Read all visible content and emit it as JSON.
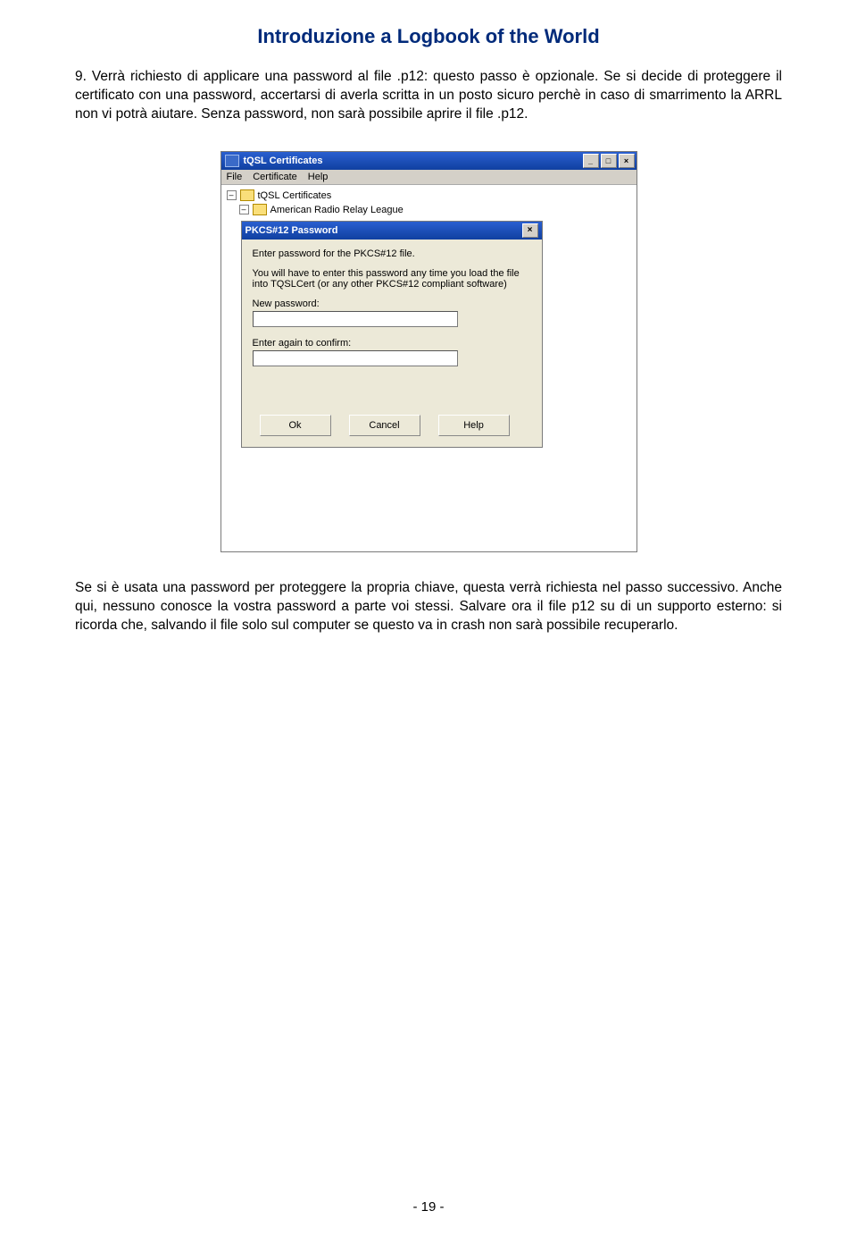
{
  "title": "Introduzione a Logbook of the World",
  "para1": "9. Verrà richiesto di applicare una password al file .p12: questo passo è opzionale. Se si decide di proteggere il certificato con una password, accertarsi di averla scritta in un posto sicuro perchè in caso di smarrimento la ARRL non vi potrà aiutare. Senza password, non sarà possibile aprire il file .p12.",
  "para2": "Se si è usata una password per proteggere la propria chiave, questa verrà richiesta nel passo successivo. Anche qui, nessuno conosce la vostra password a parte voi stessi. Salvare ora il file p12 su di un supporto esterno: si ricorda che, salvando il file solo sul computer se questo va in crash non sarà possibile recuperarlo.",
  "pagenum": "- 19 -",
  "window": {
    "title": "tQSL Certificates",
    "menu": {
      "file": "File",
      "certificate": "Certificate",
      "help": "Help"
    },
    "tree": {
      "root": "tQSL Certificates",
      "child": "American Radio Relay League"
    },
    "dialog": {
      "title": "PKCS#12 Password",
      "line1": "Enter password for the PKCS#12 file.",
      "line2": "You will have to enter this password any time you load the file into TQSLCert (or any other PKCS#12 compliant software)",
      "newpw_label": "New password:",
      "confirm_label": "Enter again to confirm:",
      "newpw_value": "",
      "confirm_value": "",
      "ok": "Ok",
      "cancel": "Cancel",
      "help": "Help"
    },
    "btn_min": "_",
    "btn_max": "□",
    "btn_close": "×"
  }
}
